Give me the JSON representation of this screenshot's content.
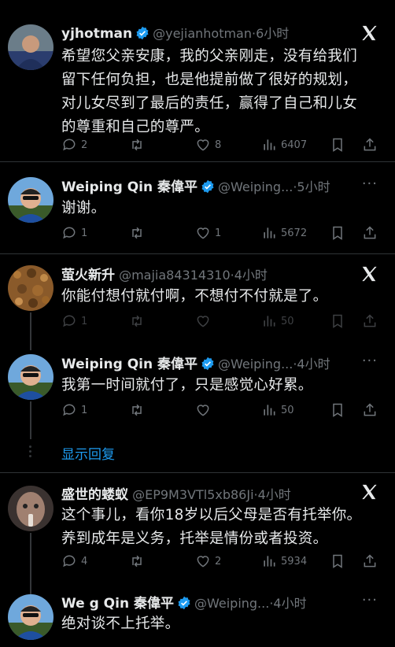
{
  "tweets": [
    {
      "name": "yjhotman",
      "handle": "@yejianhotman",
      "dot": "·",
      "time": "6小时",
      "text_lines": [
        "希望您父亲安康，我的父亲刚走，没有给我们",
        "留下任何负担，也是他提前做了很好的规划，",
        "对儿女尽到了最后的责任，赢得了自己和儿女",
        "的尊重和自己的尊严。"
      ],
      "replies": "2",
      "retweets": "",
      "likes": "8",
      "views": "6407",
      "top_icon": "x-logo-icon"
    },
    {
      "name": "Weiping Qin 秦偉平",
      "handle": "@Weiping...",
      "dot": "·",
      "time": "5小时",
      "text_lines": [
        "谢谢。"
      ],
      "replies": "1",
      "retweets": "",
      "likes": "1",
      "views": "5672",
      "top_icon": "more-icon"
    },
    {
      "name": "萤火新升",
      "handle": "@majia84314310",
      "dot": "·",
      "time": "4小时",
      "text_lines": [
        "你能付想付就付啊，不想付不付就是了。"
      ],
      "replies": "1",
      "retweets": "",
      "likes": "",
      "views": "50",
      "top_icon": "x-logo-icon"
    },
    {
      "name": "Weiping Qin 秦偉平",
      "handle": "@Weiping...",
      "dot": "·",
      "time": "4小时",
      "text_lines": [
        "我第一时间就付了，只是感觉心好累。"
      ],
      "replies": "1",
      "retweets": "",
      "likes": "",
      "views": "50",
      "top_icon": "more-icon"
    },
    {
      "name": "盛世的蝼蚁",
      "handle": "@EP9M3VTl5xb86Ji",
      "dot": "·",
      "time": "4小时",
      "text_lines": [
        "这个事儿，看你18岁以后父母是否有托举你。",
        "养到成年是义务，托举是情份或者投资。"
      ],
      "replies": "4",
      "retweets": "",
      "likes": "2",
      "views": "5934",
      "top_icon": "x-logo-icon"
    },
    {
      "name": "We  g Qin 秦偉平",
      "handle": "@Weiping...",
      "dot": "·",
      "time": "4小时",
      "text_lines": [
        "绝对谈不上托举。"
      ],
      "replies": "",
      "retweets": "",
      "likes": "",
      "views": "",
      "top_icon": "more-icon"
    }
  ],
  "show_replies": "显示回复",
  "colors": {
    "background": "#000000",
    "text": "#e7e9ea",
    "muted": "#71767b",
    "accent": "#1d9bf0",
    "divider": "#2f3336"
  }
}
